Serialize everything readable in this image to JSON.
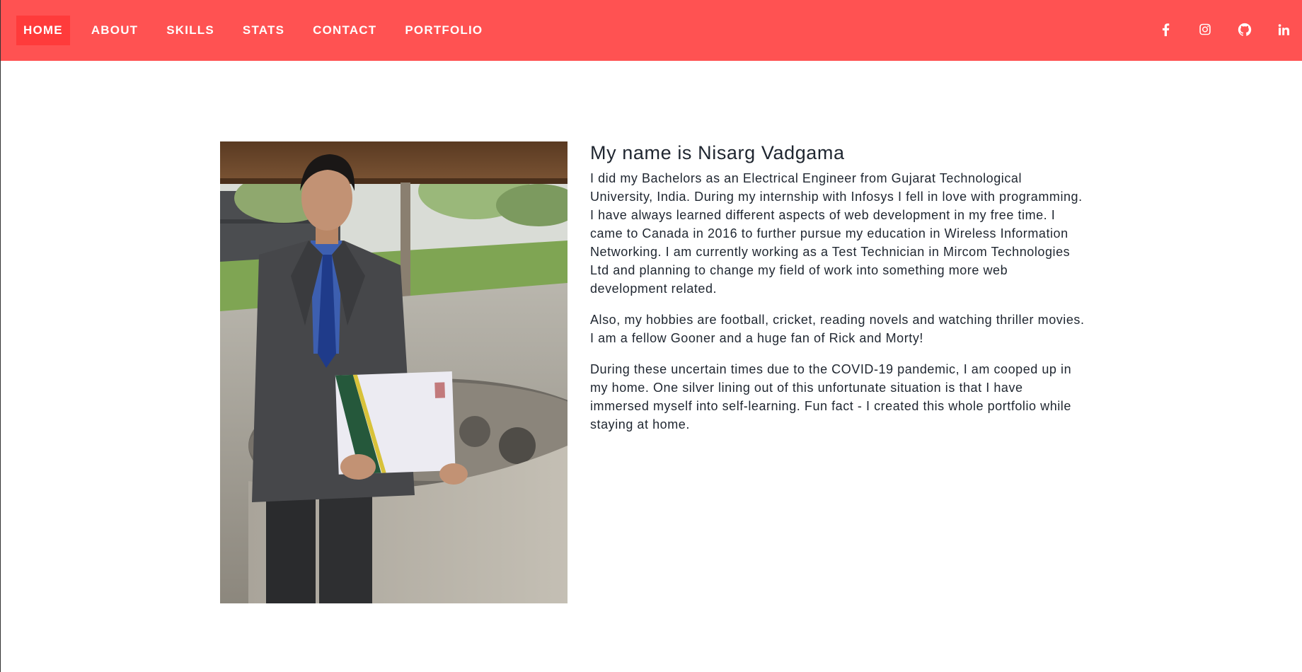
{
  "nav": {
    "items": [
      {
        "label": "HOME",
        "active": true
      },
      {
        "label": "ABOUT",
        "active": false
      },
      {
        "label": "SKILLS",
        "active": false
      },
      {
        "label": "STATS",
        "active": false
      },
      {
        "label": "CONTACT",
        "active": false
      },
      {
        "label": "PORTFOLIO",
        "active": false
      }
    ],
    "social": [
      "facebook-icon",
      "instagram-icon",
      "github-icon",
      "linkedin-icon"
    ]
  },
  "about": {
    "heading": "My name is Nisarg Vadgama",
    "paragraphs": [
      "I did my Bachelors as an Electrical Engineer from Gujarat Technological University, India. During my internship with Infosys I fell in love with programming. I have always learned different aspects of web development in my free time. I came to Canada in 2016 to further pursue my education in Wireless Information Networking. I am currently working as a Test Technician in Mircom Technologies Ltd and planning to change my field of work into something more web development related.",
      "Also, my hobbies are football, cricket, reading novels and watching thriller movies. I am a fellow Gooner and a huge fan of Rick and Morty!",
      "During these uncertain times due to the COVID-19 pandemic, I am cooped up in my home. One silver lining out of this unfortunate situation is that I have immersed myself into self-learning. Fun fact - I created this whole portfolio while staying at home."
    ]
  },
  "colors": {
    "navbar": "#ff5252",
    "active_nav": "#ff3b3b",
    "text": "#1f2630"
  }
}
